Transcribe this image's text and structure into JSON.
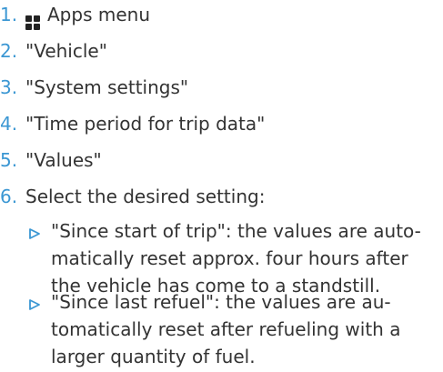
{
  "colors": {
    "accent": "#3b97d3",
    "text": "#333333"
  },
  "steps": [
    {
      "number": "1.",
      "icon": "apps-menu-icon",
      "text": "Apps menu"
    },
    {
      "number": "2.",
      "text": "\"Vehicle\""
    },
    {
      "number": "3.",
      "text": "\"System settings\""
    },
    {
      "number": "4.",
      "text": "\"Time period for trip data\""
    },
    {
      "number": "5.",
      "text": "\"Values\""
    },
    {
      "number": "6.",
      "text": "Select the desired setting:"
    }
  ],
  "options": [
    {
      "icon": "triangle-arrow-icon",
      "lines": [
        "\"Since start of trip\": the values are auto-",
        "matically reset approx. four hours after",
        "the vehicle has come to a standstill."
      ]
    },
    {
      "icon": "triangle-arrow-icon",
      "lines": [
        "\"Since last refuel\": the values are au-",
        "tomatically reset after refueling with a",
        "larger quantity of fuel."
      ]
    }
  ]
}
